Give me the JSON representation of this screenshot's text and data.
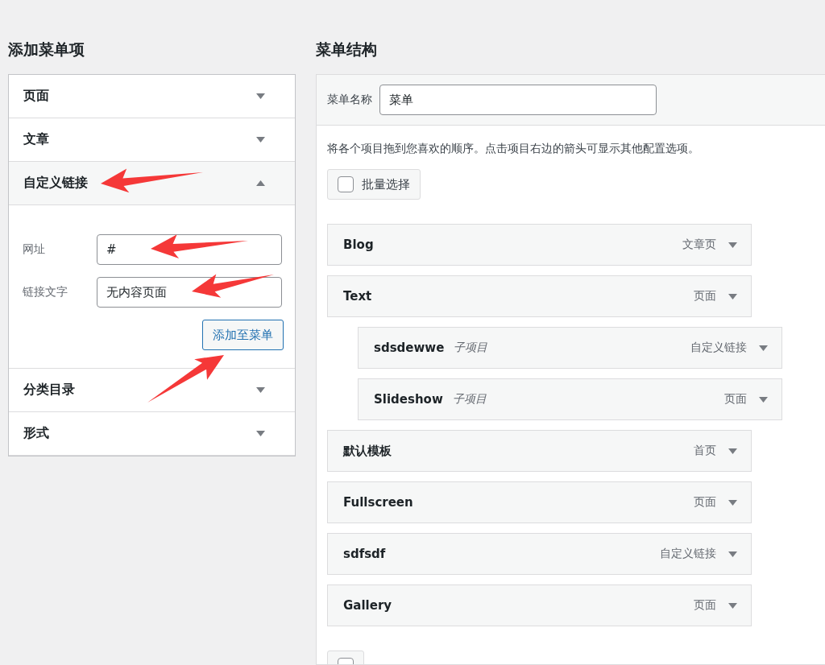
{
  "add_items": {
    "title": "添加菜单项",
    "sections": [
      {
        "title": "页面",
        "expanded": false
      },
      {
        "title": "文章",
        "expanded": false
      },
      {
        "title": "自定义链接",
        "expanded": true,
        "fields": [
          {
            "label": "网址",
            "value": "#"
          },
          {
            "label": "链接文字",
            "value": "无内容页面"
          }
        ],
        "button": "添加至菜单"
      },
      {
        "title": "分类目录",
        "expanded": false
      },
      {
        "title": "形式",
        "expanded": false
      }
    ]
  },
  "menu_structure": {
    "title": "菜单结构",
    "name_label": "菜单名称",
    "name_value": "菜单",
    "hint": "将各个项目拖到您喜欢的顺序。点击项目右边的箭头可显示其他配置选项。",
    "bulk_select": {
      "label": "批量选择",
      "checked": false
    },
    "items": [
      {
        "title": "Blog",
        "type": "文章页"
      },
      {
        "title": "Text",
        "type": "页面",
        "children": [
          {
            "title": "sdsdewwe",
            "sub_label": "子项目",
            "type": "自定义链接"
          },
          {
            "title": "Slideshow",
            "sub_label": "子项目",
            "type": "页面"
          }
        ]
      },
      {
        "title": "默认模板",
        "type": "首页"
      },
      {
        "title": "Fullscreen",
        "type": "页面"
      },
      {
        "title": "sdfsdf",
        "type": "自定义链接"
      },
      {
        "title": "Gallery",
        "type": "页面"
      }
    ],
    "bulk_select_bottom": {
      "checked": false
    }
  }
}
